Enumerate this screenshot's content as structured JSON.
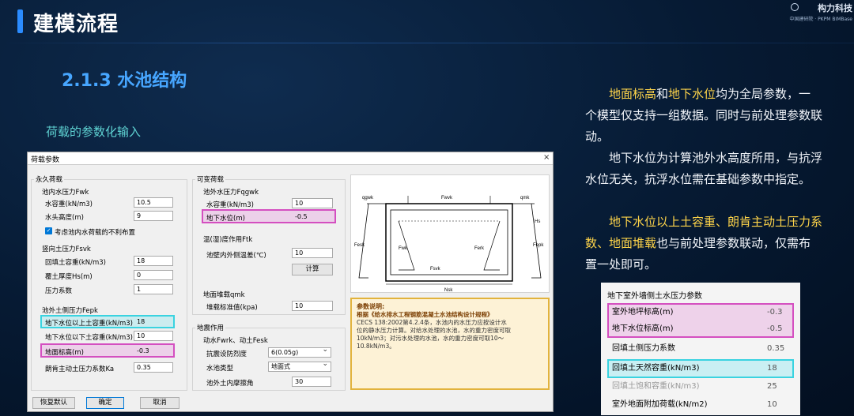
{
  "slide": {
    "title": "建模流程",
    "section": "2.1.3 水池结构",
    "subtitle": "荷载的参数化输入",
    "logo_text": "构力科技",
    "logo_sub": "中国建研院 · PKPM BIMBase"
  },
  "notes": {
    "p1_a": "地面标高",
    "p1_b": "和",
    "p1_c": "地下水位",
    "p1_d": "均为全局参数，一个模型仅支持一组数据。同时与前处理参数联动。",
    "p2": "地下水位为计算池外水高度所用，与抗浮水位无关，抗浮水位需在基础参数中指定。",
    "p3_a": "地下水位以上土容重、朗肯主动土压力系数、地面堆载",
    "p3_b": "也与前处理参数联动，仅需布置一处即可。"
  },
  "dialog": {
    "title": "荷载参数",
    "close": "×",
    "permanent": {
      "group": "永久荷载",
      "inner_water": {
        "label": "池内水压力Fwk",
        "unit_weight_label": "水容重(kN/m3)",
        "unit_weight": "10.5",
        "height_label": "水头高度(m)",
        "height": "9",
        "checkbox_label": "考虑池内水荷载的不利布置"
      },
      "vertical_soil": {
        "label": "竖向土压力Fsvk",
        "backfill_label": "回填土容重(kN/m3)",
        "backfill": "18",
        "cover_label": "覆土厚度Hs(m)",
        "cover": "0",
        "factor_label": "压力系数",
        "factor": "1"
      },
      "lateral_soil": {
        "label": "池外土侧压力Fepk",
        "above_label": "地下水位以上土容重(kN/m3)",
        "above": "18",
        "below_label": "地下水位以下土容重(kN/m3)",
        "below": "10",
        "ground_label": "地面标高(m)",
        "ground": "-0.3",
        "rankine_label": "朗肯主动土压力系数Ka",
        "rankine": "0.35"
      }
    },
    "variable": {
      "group": "可变荷载",
      "outer_water": {
        "label": "池外水压力Fqgwk",
        "unit_weight_label": "水容重(kN/m3)",
        "unit_weight": "10",
        "level_label": "地下水位(m)",
        "level": "-0.5"
      },
      "temperature": {
        "label": "温(湿)度作用Ftk",
        "diff_label": "池壁内外侧温差(℃)",
        "diff": "10",
        "calc_button": "计算"
      },
      "surcharge": {
        "label": "地面堆载qmk",
        "std_label": "堆载标准值(kpa)",
        "std": "10"
      }
    },
    "seismic": {
      "group": "地震作用",
      "label": "动水Fwrk、动土Fesk",
      "intensity_label": "抗震设防烈度",
      "intensity": "6(0.05g)",
      "type_label": "水池类型",
      "type": "地面式",
      "friction_label": "池外土内摩擦角",
      "friction": "30"
    },
    "diagram": {
      "qgwk": "qgwk",
      "qmk": "qmk",
      "fwvk": "Fwvk",
      "fesk": "Fesk",
      "fepk": "Fepk",
      "fwk": "Fwk",
      "ferk": "Ferk",
      "fsvk": "Fsvk",
      "hs": "Hs",
      "nsk": "Nsk"
    },
    "description": {
      "head": "参数说明:",
      "line1": "根据《给水排水工程钢筋混凝土水池结构设计规程》",
      "line2": "CECS 138:2002第4.2.4条，水池内的水压力应按设计水",
      "line3": "位的静水压力计算。对给水处理的水池，水的重力密度可取",
      "line4": "10kN/m3；对污水处理的水池，水的重力密度可取10～",
      "line5": "10.8kN/m3。"
    },
    "buttons": {
      "restore": "恢复默认",
      "ok": "确定",
      "cancel": "取消"
    }
  },
  "panel": {
    "title": "地下室外墙侧土水压力参数",
    "rows": [
      {
        "label": "室外地坪标高(m)",
        "value": "-0.3"
      },
      {
        "label": "地下水位标高(m)",
        "value": "-0.5"
      },
      {
        "label": "回填土侧压力系数",
        "value": "0.35"
      },
      {
        "label": "回填土天然容重(kN/m3)",
        "value": "18"
      },
      {
        "label": "回填土饱和容重(kN/m3)",
        "value": "25"
      },
      {
        "label": "室外地面附加荷载(kN/m2)",
        "value": "10"
      }
    ]
  }
}
